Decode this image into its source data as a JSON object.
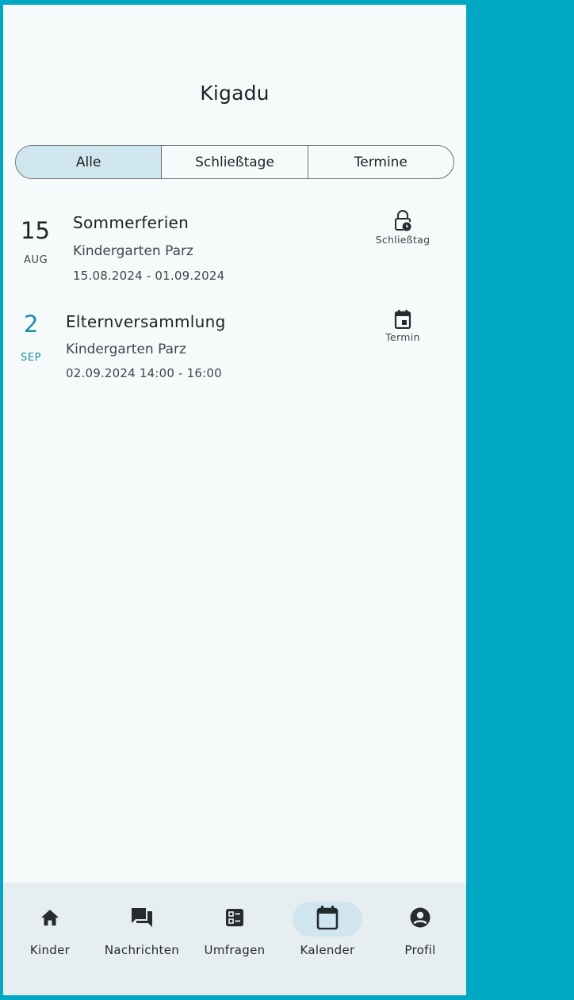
{
  "app": {
    "title": "Kigadu"
  },
  "filter": {
    "tabs": [
      "Alle",
      "Schließtage",
      "Termine"
    ],
    "active": "Alle"
  },
  "events": [
    {
      "day": "15",
      "month": "AUG",
      "title": "Sommerferien",
      "org": "Kindergarten Parz",
      "dates": "15.08.2024 - 01.09.2024",
      "type_label": "Schließtag",
      "icon": "lock-clock-icon",
      "date_color": "#1d2224"
    },
    {
      "day": "2",
      "month": "SEP",
      "title": "Elternversammlung",
      "org": "Kindergarten Parz",
      "dates": "02.09.2024 14:00 - 16:00",
      "type_label": "Termin",
      "icon": "calendar-icon",
      "date_color": "#1e8ea3"
    }
  ],
  "bottom_nav": {
    "items": [
      {
        "label": "Kinder",
        "icon": "home-icon"
      },
      {
        "label": "Nachrichten",
        "icon": "chat-icon"
      },
      {
        "label": "Umfragen",
        "icon": "poll-icon"
      },
      {
        "label": "Kalender",
        "icon": "calendar-icon",
        "active": true
      },
      {
        "label": "Profil",
        "icon": "account-icon"
      }
    ]
  },
  "colors": {
    "accent": "#00a7c3",
    "selected_bg": "#cfe6ee",
    "sep_date": "#1e8ea3"
  }
}
